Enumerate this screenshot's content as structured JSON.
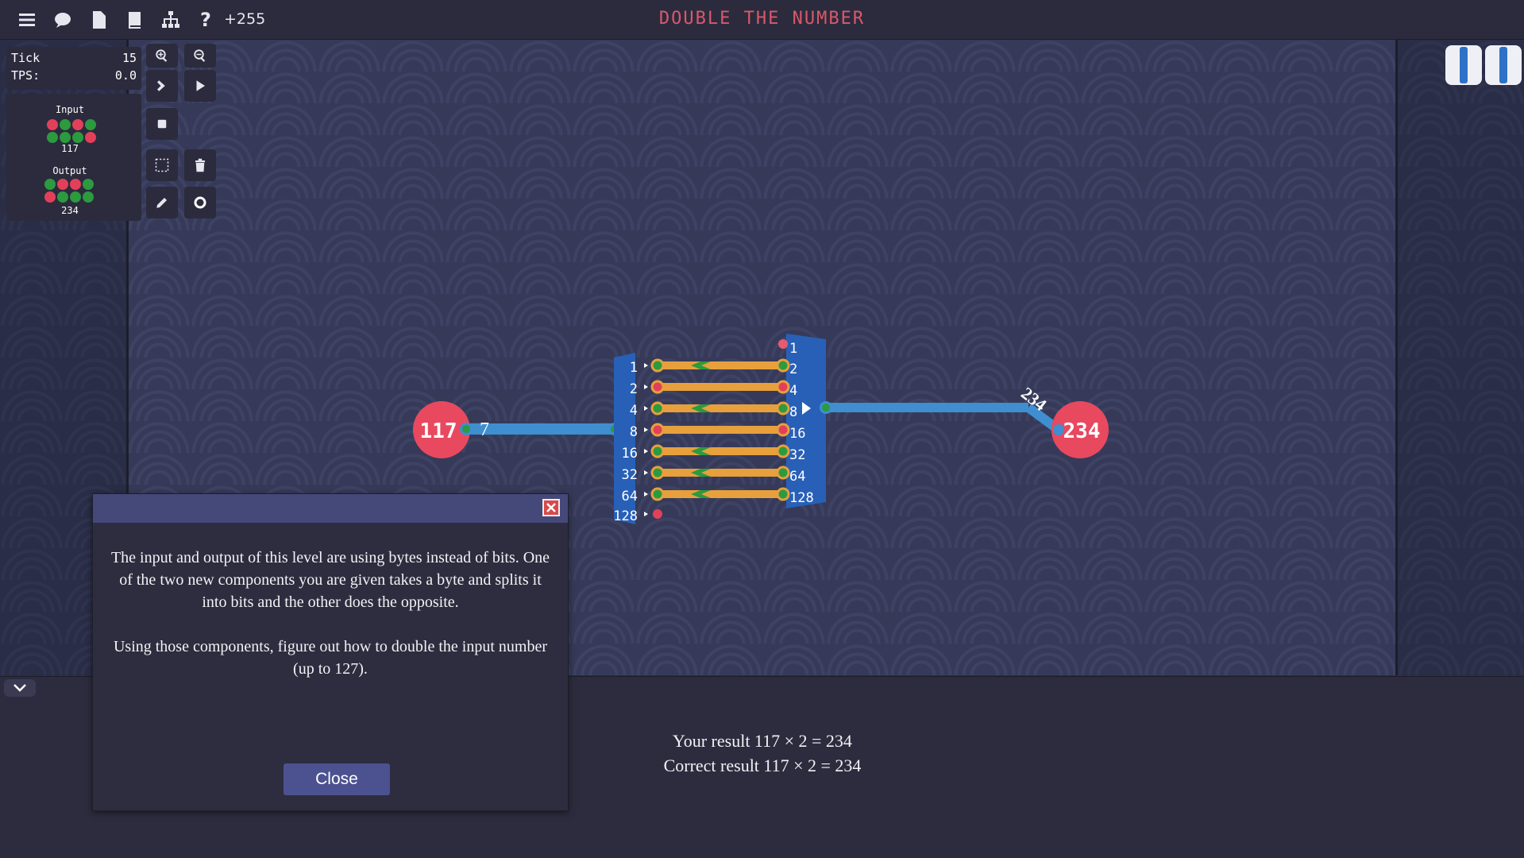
{
  "toolbar": {
    "icons": [
      "menu-icon",
      "chat-icon",
      "document-icon",
      "book-icon",
      "hierarchy-icon",
      "help-icon"
    ],
    "help_glyph": "?",
    "score": "+255"
  },
  "title": "DOUBLE THE NUMBER",
  "stats": {
    "tick_label": "Tick",
    "tick_value": "15",
    "tps_label": "TPS:",
    "tps_value": "0.0"
  },
  "io_panel": {
    "input_label": "Input",
    "input_value": "117",
    "input_bits": [
      false,
      true,
      false,
      true,
      true,
      true,
      true,
      false
    ],
    "output_label": "Output",
    "output_value": "234",
    "output_bits": [
      true,
      false,
      false,
      true,
      false,
      true,
      true,
      true
    ]
  },
  "circuit": {
    "input_node": "117",
    "input_wire_label": "7",
    "output_node": "234",
    "output_wire_label": "234",
    "splitter_labels": [
      "1",
      "2",
      "4",
      "8",
      "16",
      "32",
      "64",
      "128"
    ],
    "maker_labels": [
      "1",
      "2",
      "4",
      "8",
      "16",
      "32",
      "64",
      "128"
    ],
    "colors": {
      "input_node": "#e8495f",
      "wire": "#3f8ed0",
      "bus": "#e7a03c",
      "component": "#2860b8",
      "on": "#2c9a3e",
      "off": "#e2405a"
    }
  },
  "dialog": {
    "paragraph1": "The input and output of this level are using bytes instead of bits. One of the two new components you are given takes a byte and splits it into bits and the other does the opposite.",
    "paragraph2": "Using those components, figure out how to double the input number (up to 127).",
    "close_label": "Close"
  },
  "results": {
    "yours": "Your result 117 × 2 = 234",
    "correct": "Correct result 117 × 2 = 234"
  }
}
